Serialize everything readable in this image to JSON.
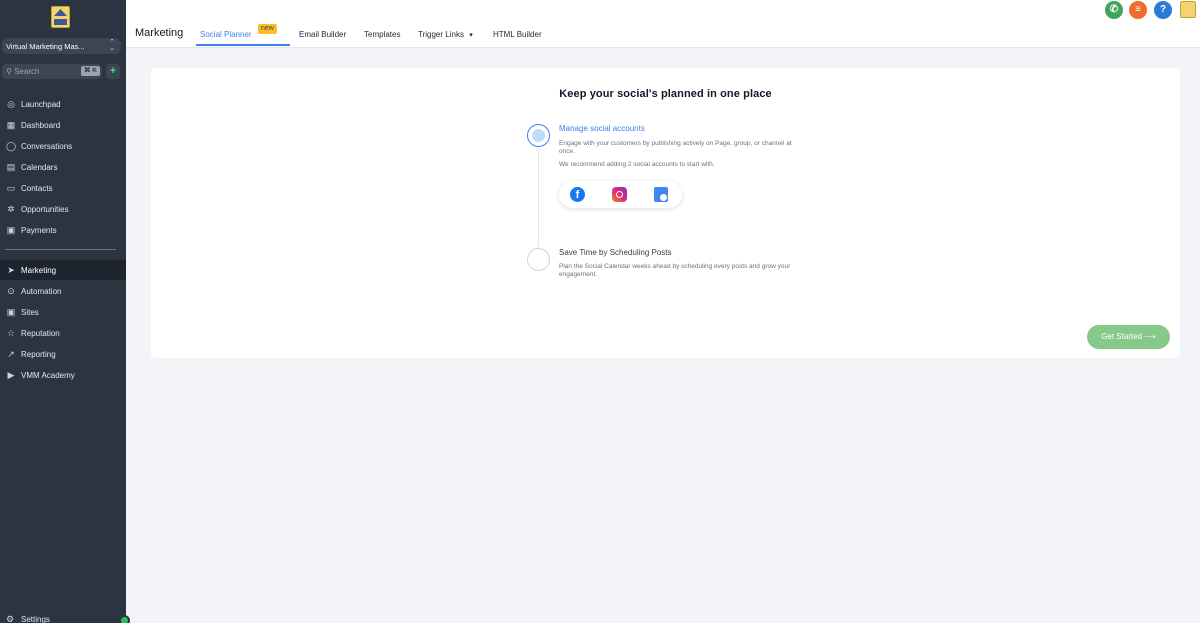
{
  "sidebar": {
    "account_name": "Virtual Marketing Mas...",
    "search": {
      "placeholder": "Search",
      "shortcut": "⌘ K"
    },
    "items": [
      {
        "label": "Launchpad",
        "icon": "rocket-icon"
      },
      {
        "label": "Dashboard",
        "icon": "grid-icon"
      },
      {
        "label": "Conversations",
        "icon": "chat-icon"
      },
      {
        "label": "Calendars",
        "icon": "calendar-icon"
      },
      {
        "label": "Contacts",
        "icon": "contacts-icon"
      },
      {
        "label": "Opportunities",
        "icon": "opportunities-icon"
      },
      {
        "label": "Payments",
        "icon": "payments-icon"
      }
    ],
    "items2": [
      {
        "label": "Marketing",
        "icon": "send-icon",
        "active": true
      },
      {
        "label": "Automation",
        "icon": "automation-icon"
      },
      {
        "label": "Sites",
        "icon": "sites-icon"
      },
      {
        "label": "Reputation",
        "icon": "star-icon"
      },
      {
        "label": "Reporting",
        "icon": "trend-icon"
      },
      {
        "label": "VMM Academy",
        "icon": "youtube-icon"
      }
    ],
    "settings_label": "Settings"
  },
  "header": {
    "title": "Marketing",
    "tabs": [
      {
        "label": "Social Planner",
        "active": true,
        "badge": "new"
      },
      {
        "label": "Email Builder"
      },
      {
        "label": "Templates"
      },
      {
        "label": "Trigger Links"
      },
      {
        "label": "HTML Builder"
      }
    ],
    "icons": [
      {
        "name": "phone-icon",
        "color": "#3ea55b"
      },
      {
        "name": "list-icon",
        "color": "#ef6c2d"
      },
      {
        "name": "help-icon",
        "color": "#2b7bd8"
      }
    ]
  },
  "card": {
    "title": "Keep your social's planned in one place",
    "step1": {
      "title": "Manage social accounts",
      "text": "Engage with your customers by publishing actively on Page, group, or channel at once.",
      "note": "We recommend adding 2 social accounts to start with."
    },
    "step2": {
      "title": "Save Time by Scheduling Posts",
      "text": "Plan the Social Calendar weeks ahead by scheduling every posts and grow your engagement."
    },
    "cta": "Get Started ⟶"
  },
  "colors": {
    "sidebar_bg": "#2b3440",
    "accent": "#3b82f6",
    "cta": "#86c98a",
    "badge": "#fbbf24"
  }
}
